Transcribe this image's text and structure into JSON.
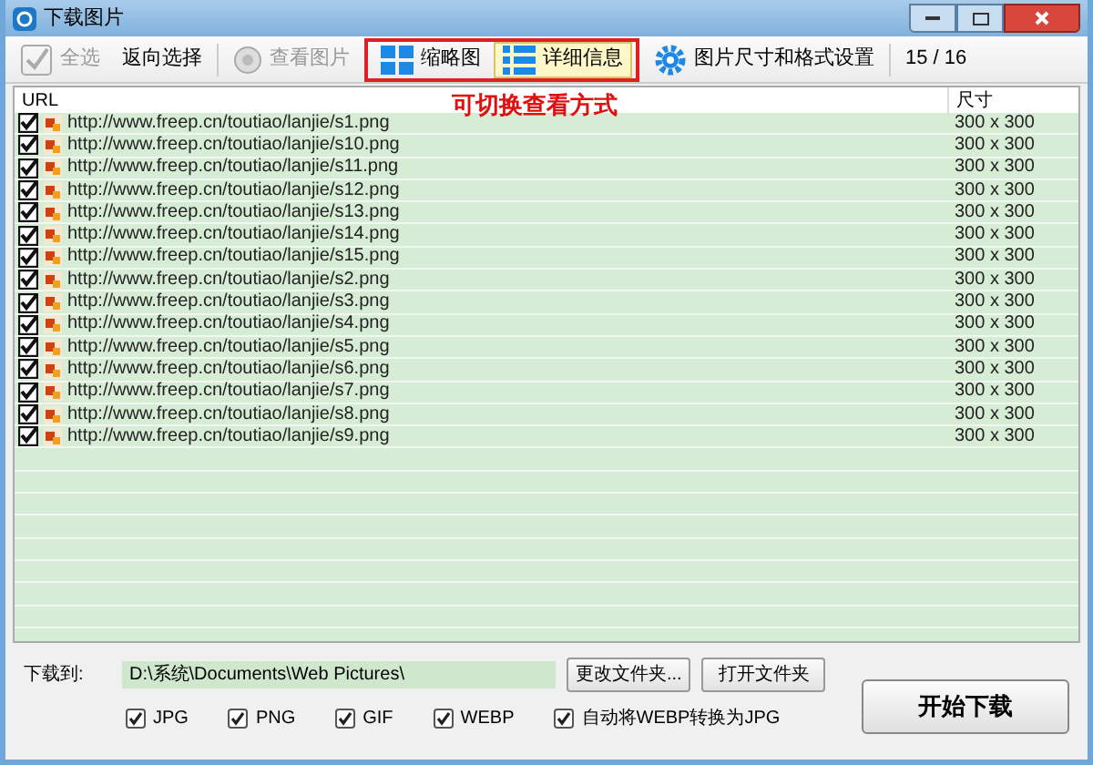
{
  "window": {
    "title": "下载图片"
  },
  "toolbar": {
    "select_all": {
      "label": "全选",
      "checked": true,
      "disabled": true
    },
    "invert": {
      "label": "返向选择"
    },
    "view_image": {
      "label": "查看图片",
      "disabled": true
    },
    "views": [
      {
        "label": "缩略图",
        "kind": "grid",
        "selected": false
      },
      {
        "label": "详细信息",
        "kind": "list",
        "selected": true
      }
    ],
    "settings": {
      "label": "图片尺寸和格式设置"
    },
    "count": "15 / 16"
  },
  "annotation": "可切换查看方式",
  "table": {
    "columns": [
      "URL",
      "尺寸"
    ],
    "rows": [
      {
        "checked": true,
        "url": "http://www.freep.cn/toutiao/lanjie/s1.png",
        "size": "300 x 300"
      },
      {
        "checked": true,
        "url": "http://www.freep.cn/toutiao/lanjie/s10.png",
        "size": "300 x 300"
      },
      {
        "checked": true,
        "url": "http://www.freep.cn/toutiao/lanjie/s11.png",
        "size": "300 x 300"
      },
      {
        "checked": true,
        "url": "http://www.freep.cn/toutiao/lanjie/s12.png",
        "size": "300 x 300"
      },
      {
        "checked": true,
        "url": "http://www.freep.cn/toutiao/lanjie/s13.png",
        "size": "300 x 300"
      },
      {
        "checked": true,
        "url": "http://www.freep.cn/toutiao/lanjie/s14.png",
        "size": "300 x 300"
      },
      {
        "checked": true,
        "url": "http://www.freep.cn/toutiao/lanjie/s15.png",
        "size": "300 x 300"
      },
      {
        "checked": true,
        "url": "http://www.freep.cn/toutiao/lanjie/s2.png",
        "size": "300 x 300"
      },
      {
        "checked": true,
        "url": "http://www.freep.cn/toutiao/lanjie/s3.png",
        "size": "300 x 300"
      },
      {
        "checked": true,
        "url": "http://www.freep.cn/toutiao/lanjie/s4.png",
        "size": "300 x 300"
      },
      {
        "checked": true,
        "url": "http://www.freep.cn/toutiao/lanjie/s5.png",
        "size": "300 x 300"
      },
      {
        "checked": true,
        "url": "http://www.freep.cn/toutiao/lanjie/s6.png",
        "size": "300 x 300"
      },
      {
        "checked": true,
        "url": "http://www.freep.cn/toutiao/lanjie/s7.png",
        "size": "300 x 300"
      },
      {
        "checked": true,
        "url": "http://www.freep.cn/toutiao/lanjie/s8.png",
        "size": "300 x 300"
      },
      {
        "checked": true,
        "url": "http://www.freep.cn/toutiao/lanjie/s9.png",
        "size": "300 x 300"
      }
    ]
  },
  "download": {
    "label": "下载到:",
    "path": "D:\\系统\\Documents\\Web Pictures\\",
    "change_button": "更改文件夹...",
    "open_button": "打开文件夹",
    "formats": [
      {
        "label": "JPG",
        "checked": true
      },
      {
        "label": "PNG",
        "checked": true
      },
      {
        "label": "GIF",
        "checked": true
      },
      {
        "label": "WEBP",
        "checked": true
      },
      {
        "label": "自动将WEBP转换为JPG",
        "checked": true
      }
    ],
    "start_button": "开始下载"
  }
}
